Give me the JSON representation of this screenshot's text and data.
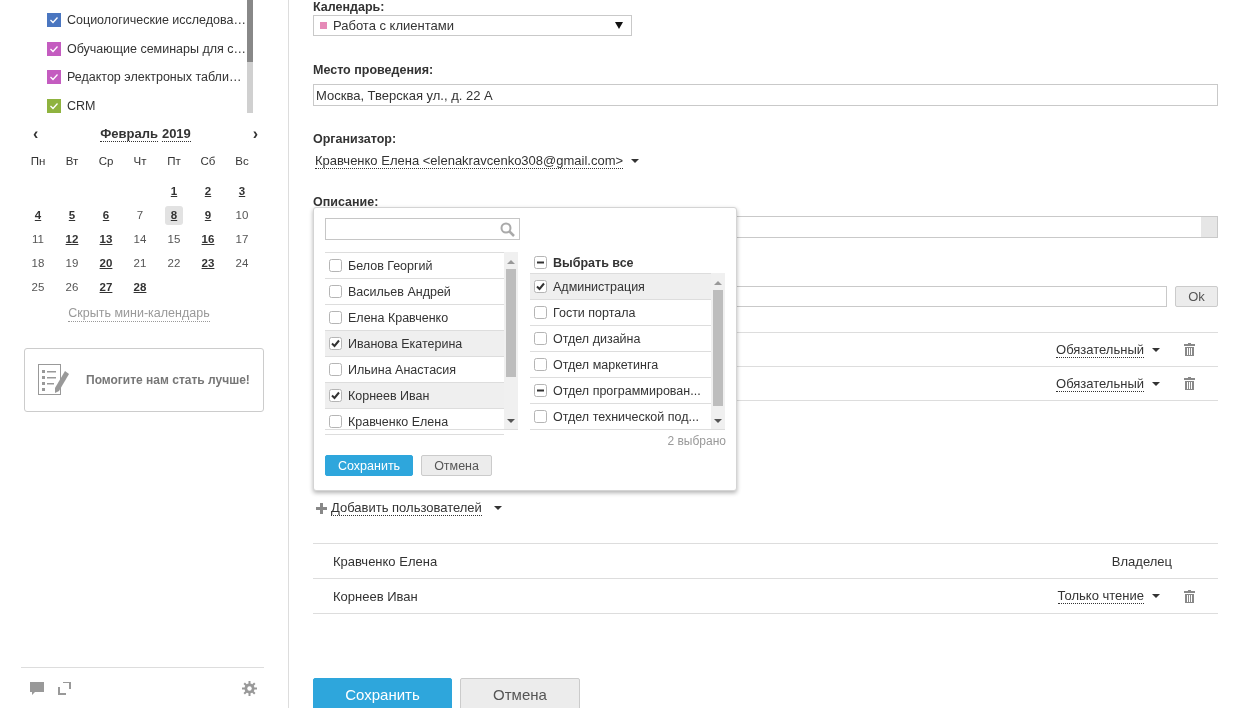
{
  "sidebar": {
    "calendars": [
      {
        "label": "Социологические исследова…",
        "color": "#4a76c0",
        "checked": true
      },
      {
        "label": "Обучающие семинары для с…",
        "color": "#c45cc0",
        "checked": true
      },
      {
        "label": "Редактор электроных табли…",
        "color": "#c45cc0",
        "checked": true
      },
      {
        "label": "CRM",
        "color": "#8fb33f",
        "checked": true
      }
    ],
    "mini_calendar": {
      "prev": "‹",
      "month": "Февраль",
      "year": "2019",
      "next": "›",
      "weekdays": [
        "Пн",
        "Вт",
        "Ср",
        "Чт",
        "Пт",
        "Сб",
        "Вс"
      ],
      "weeks": [
        [
          {
            "kind": "empty"
          },
          {
            "kind": "empty"
          },
          {
            "kind": "empty"
          },
          {
            "kind": "empty"
          },
          {
            "kind": "day",
            "day": "1",
            "has_events": true,
            "today": false
          },
          {
            "kind": "day",
            "day": "2",
            "has_events": true,
            "today": false
          },
          {
            "kind": "day",
            "day": "3",
            "has_events": true,
            "today": false
          }
        ],
        [
          {
            "kind": "day",
            "day": "4",
            "has_events": true,
            "today": false
          },
          {
            "kind": "day",
            "day": "5",
            "has_events": true,
            "today": false
          },
          {
            "kind": "day",
            "day": "6",
            "has_events": true,
            "today": false
          },
          {
            "kind": "day",
            "day": "7",
            "has_events": false,
            "today": false
          },
          {
            "kind": "day",
            "day": "8",
            "has_events": true,
            "today": true
          },
          {
            "kind": "day",
            "day": "9",
            "has_events": true,
            "today": false
          },
          {
            "kind": "day",
            "day": "10",
            "has_events": false,
            "today": false
          }
        ],
        [
          {
            "kind": "day",
            "day": "11",
            "has_events": false,
            "today": false
          },
          {
            "kind": "day",
            "day": "12",
            "has_events": true,
            "today": false
          },
          {
            "kind": "day",
            "day": "13",
            "has_events": true,
            "today": false
          },
          {
            "kind": "day",
            "day": "14",
            "has_events": false,
            "today": false
          },
          {
            "kind": "day",
            "day": "15",
            "has_events": false,
            "today": false
          },
          {
            "kind": "day",
            "day": "16",
            "has_events": true,
            "today": false
          },
          {
            "kind": "day",
            "day": "17",
            "has_events": false,
            "today": false
          }
        ],
        [
          {
            "kind": "day",
            "day": "18",
            "has_events": false,
            "today": false
          },
          {
            "kind": "day",
            "day": "19",
            "has_events": false,
            "today": false
          },
          {
            "kind": "day",
            "day": "20",
            "has_events": true,
            "today": false
          },
          {
            "kind": "day",
            "day": "21",
            "has_events": false,
            "today": false
          },
          {
            "kind": "day",
            "day": "22",
            "has_events": false,
            "today": false
          },
          {
            "kind": "day",
            "day": "23",
            "has_events": true,
            "today": false
          },
          {
            "kind": "day",
            "day": "24",
            "has_events": false,
            "today": false
          }
        ],
        [
          {
            "kind": "day",
            "day": "25",
            "has_events": false,
            "today": false
          },
          {
            "kind": "day",
            "day": "26",
            "has_events": false,
            "today": false
          },
          {
            "kind": "day",
            "day": "27",
            "has_events": true,
            "today": false
          },
          {
            "kind": "day",
            "day": "28",
            "has_events": true,
            "today": false
          },
          {
            "kind": "empty"
          },
          {
            "kind": "empty"
          },
          {
            "kind": "empty"
          }
        ]
      ],
      "hide_link": "Скрыть мини-календарь"
    },
    "feedback": "Помогите нам стать лучше!"
  },
  "form": {
    "calendar_label": "Календарь:",
    "calendar_value": {
      "text": "Работа с клиентами",
      "color": "#e68ab8"
    },
    "location_label": "Место проведения:",
    "location_value": "Москва, Тверская ул., д. 22 А",
    "organizer_label": "Организатор:",
    "organizer_value": "Кравченко Елена <elenakravcenko308@gmail.com>",
    "description_label": "Описание:",
    "invite_button": "Ok",
    "attendees": [
      {
        "role": "Обязательный"
      },
      {
        "role": "Обязательный"
      }
    ],
    "add_users": "Добавить пользователей",
    "access": [
      {
        "name": "Кравченко Елена",
        "role": "Владелец",
        "kind": "owner"
      },
      {
        "name": "Корнеев Иван",
        "role": "Только чтение",
        "kind": "member"
      }
    ],
    "save": "Сохранить",
    "cancel": "Отмена"
  },
  "user_picker": {
    "users": [
      {
        "name": "Белов Георгий",
        "checked": false,
        "selected": false
      },
      {
        "name": "Васильев Андрей",
        "checked": false,
        "selected": false
      },
      {
        "name": "Елена Кравченко",
        "checked": false,
        "selected": false
      },
      {
        "name": "Иванова Екатерина",
        "checked": true,
        "selected": true
      },
      {
        "name": "Ильина Анастасия",
        "checked": false,
        "selected": false
      },
      {
        "name": "Корнеев Иван",
        "checked": true,
        "selected": true
      },
      {
        "name": "Кравченко Елена",
        "checked": false,
        "selected": false
      }
    ],
    "select_all": {
      "label": "Выбрать все",
      "checked": false,
      "partial": true
    },
    "groups": [
      {
        "name": "Администрация",
        "checked": true,
        "partial": false,
        "selected": true
      },
      {
        "name": "Гости портала",
        "checked": false,
        "partial": false,
        "selected": false
      },
      {
        "name": "Отдел дизайна",
        "checked": false,
        "partial": false,
        "selected": false
      },
      {
        "name": "Отдел маркетинга",
        "checked": false,
        "partial": false,
        "selected": false
      },
      {
        "name": "Отдел программирован...",
        "checked": false,
        "partial": true,
        "selected": false
      },
      {
        "name": "Отдел технической под...",
        "checked": false,
        "partial": false,
        "selected": false
      }
    ],
    "count": "2 выбрано",
    "save": "Сохранить",
    "cancel": "Отмена"
  }
}
